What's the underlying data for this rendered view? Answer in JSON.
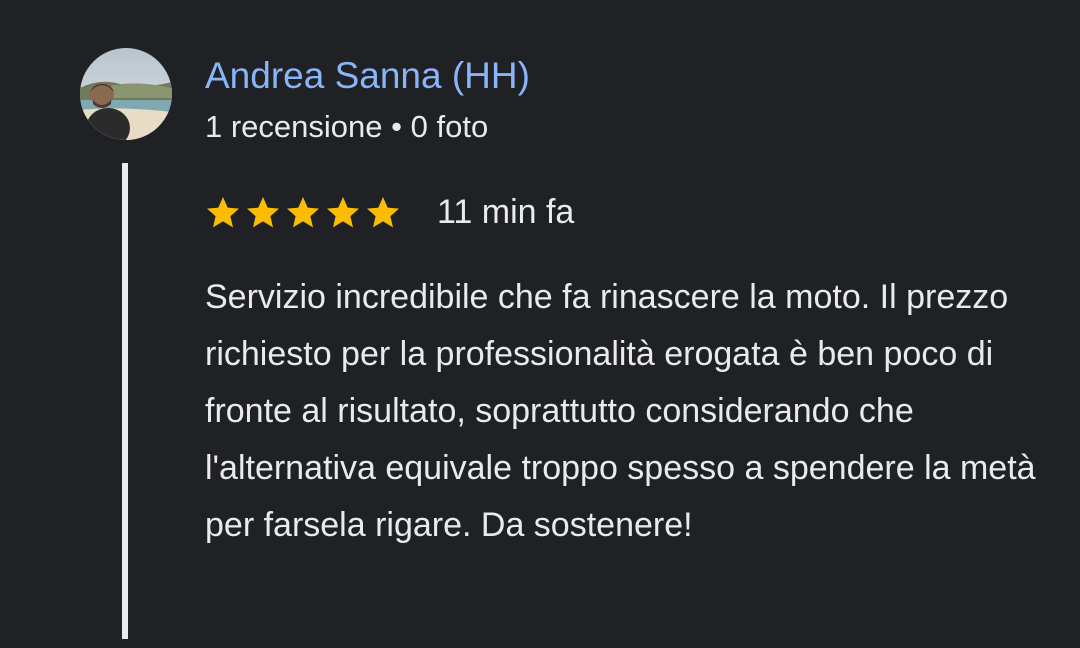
{
  "review": {
    "author": {
      "name": "Andrea Sanna (HH)",
      "reviews_count": "1 recensione",
      "separator": "•",
      "photos_count": "0 foto",
      "avatar_icon": "user-avatar-photo"
    },
    "rating": {
      "stars": 5,
      "max_stars": 5,
      "star_color": "#fbbc04",
      "time_ago": "11 min fa"
    },
    "text": "Servizio incredibile che fa rinascere la moto. Il prezzo richiesto per la professionalità erogata è ben poco di fronte al risultato, soprattutto considerando che l'alternativa equivale troppo spesso a spendere la metà per farsela rigare. Da sostenere!"
  },
  "colors": {
    "background": "#202124",
    "author_link": "#8ab4f8",
    "text": "#e8eaed",
    "star": "#fbbc04"
  }
}
